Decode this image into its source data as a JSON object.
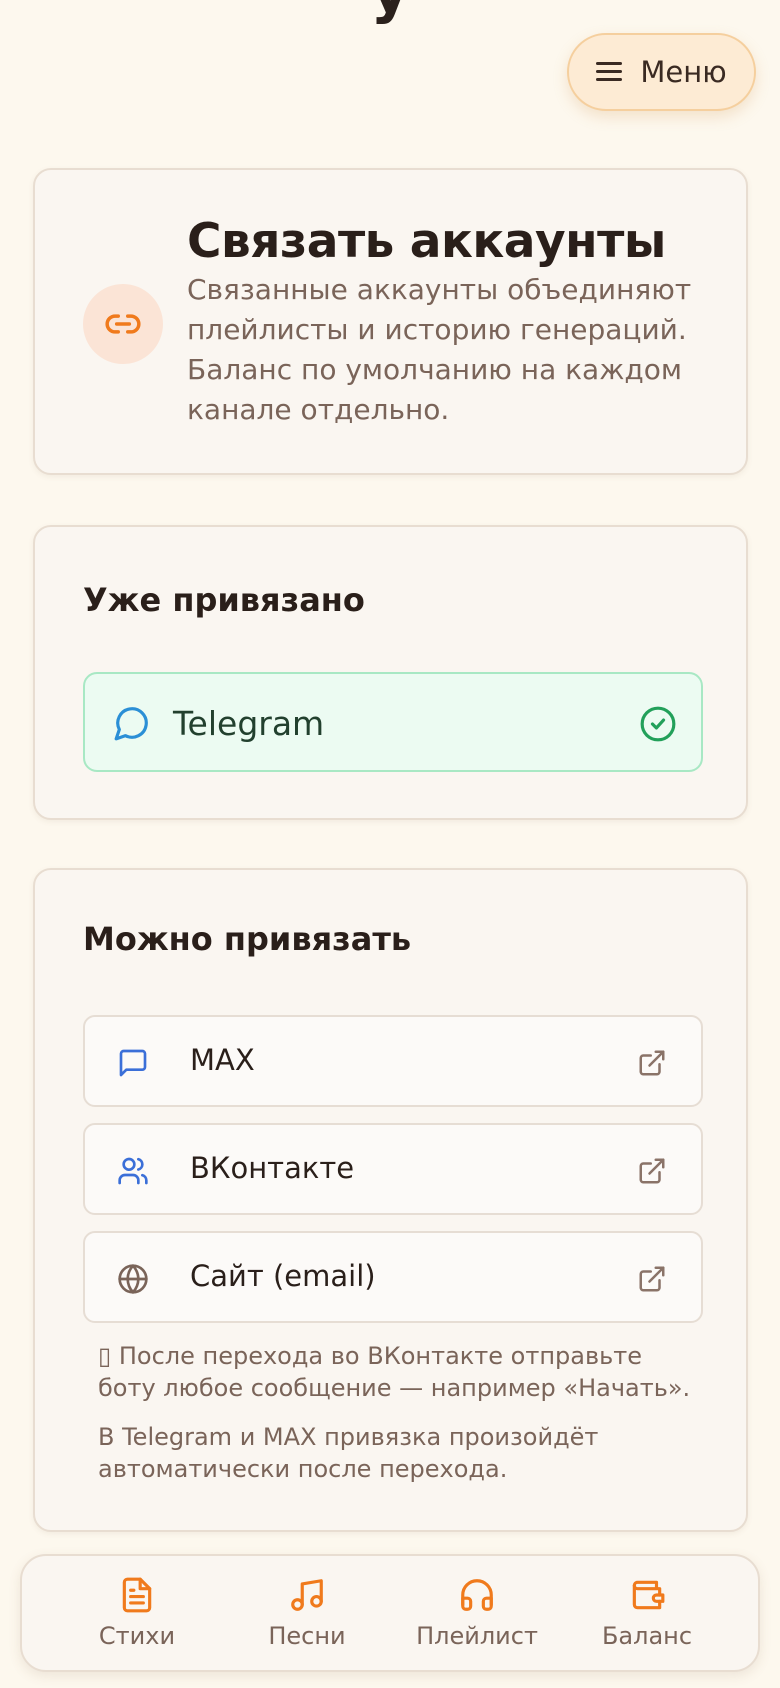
{
  "header": {
    "menu_label": "Меню"
  },
  "link_card": {
    "title": "Связать аккаунты",
    "description": "Связанные аккаунты объединяют плейлисты и историю генераций. Баланс по умолчанию на каждом канале отдельно."
  },
  "linked": {
    "title": "Уже привязано",
    "items": [
      {
        "label": "Telegram",
        "icon": "chat-bubble-icon",
        "status": "linked"
      }
    ]
  },
  "linkable": {
    "title": "Можно привязать",
    "items": [
      {
        "label": "MAX",
        "icon": "message-square-icon"
      },
      {
        "label": "ВКонтакте",
        "icon": "users-icon"
      },
      {
        "label": "Сайт (email)",
        "icon": "globe-icon"
      }
    ],
    "note_vk": "▯ После перехода во ВКонтакте отправьте боту любое сообщение — например «Начать».",
    "note_auto": "В Telegram и MAX привязка произойдёт автоматически после перехода."
  },
  "nav": {
    "items": [
      {
        "label": "Стихи",
        "icon": "file-text-icon"
      },
      {
        "label": "Песни",
        "icon": "music-icon"
      },
      {
        "label": "Плейлист",
        "icon": "headphones-icon"
      },
      {
        "label": "Баланс",
        "icon": "wallet-icon"
      }
    ]
  },
  "colors": {
    "accent": "#f07a1c",
    "background": "#fdf8ee",
    "linked_bg": "#ecfbf2",
    "linked_check": "#22a05a",
    "telegram_icon": "#2b8fd6",
    "max_icon": "#3b6fd8",
    "vk_icon": "#3b6fd8"
  }
}
